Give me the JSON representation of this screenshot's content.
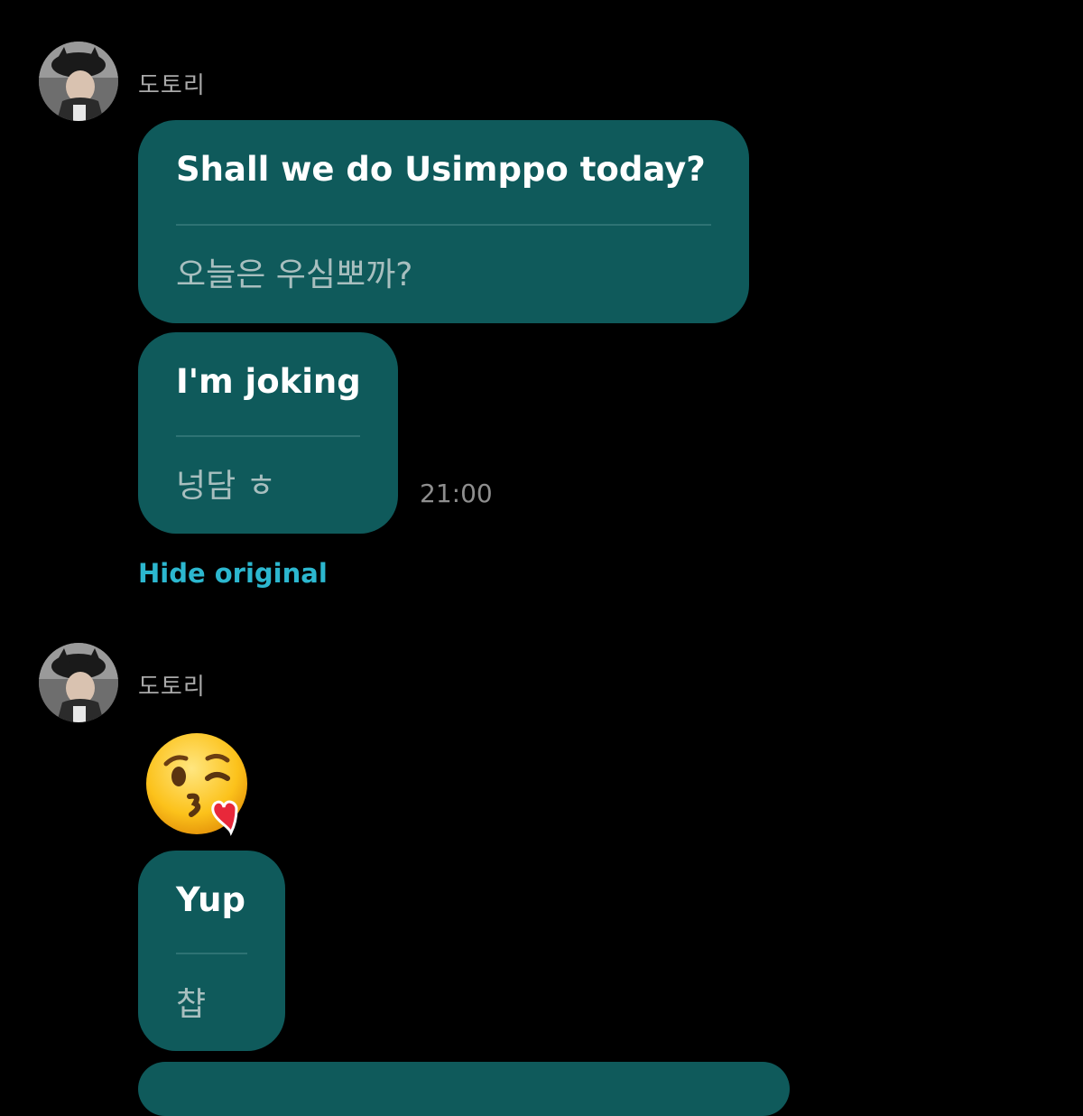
{
  "groups": [
    {
      "sender": "도토리",
      "messages": [
        {
          "translated": "Shall we do Usimppo today?",
          "original": "오늘은 우심뽀까?"
        },
        {
          "translated": "I'm joking",
          "original": "넝담 ㅎ",
          "time": "21:00"
        }
      ],
      "hide_original_label": "Hide original"
    },
    {
      "sender": "도토리",
      "emoji": "face-blowing-a-kiss",
      "messages": [
        {
          "translated": "Yup",
          "original": "챱"
        }
      ]
    }
  ],
  "colors": {
    "background": "#000000",
    "bubble": "#0f5a5b",
    "link": "#2cb7cf",
    "sender_name": "#a9a9a9",
    "timestamp": "#8e8e8e"
  }
}
